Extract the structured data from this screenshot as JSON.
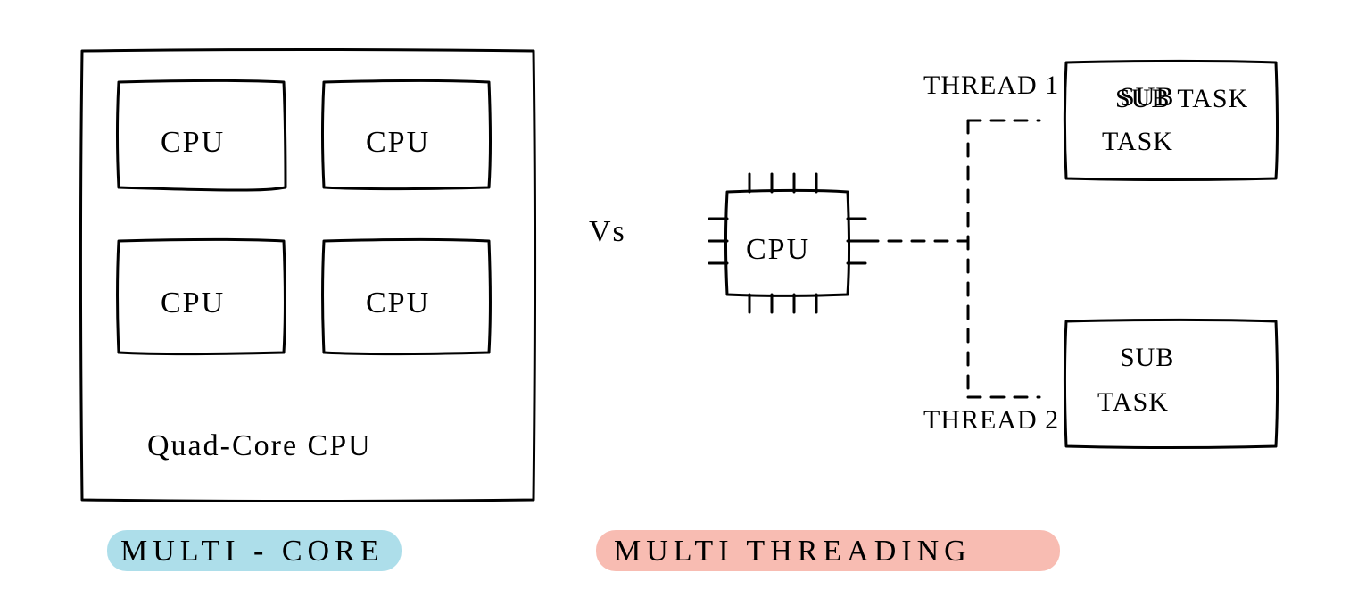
{
  "left": {
    "cores": [
      "CPU",
      "CPU",
      "CPU",
      "CPU"
    ],
    "inner_caption": "Quad-Core  CPU",
    "title": "MULTI - CORE"
  },
  "vs": "Vs",
  "right": {
    "cpu": "CPU",
    "threads": [
      "THREAD 1",
      "THREAD 2"
    ],
    "subtasks": [
      "SUB TASK",
      "SUB TASK"
    ],
    "title": "MULTI  THREADING"
  },
  "colors": {
    "highlight_blue": "#9fd8e6",
    "highlight_red": "#f7b0a5"
  }
}
